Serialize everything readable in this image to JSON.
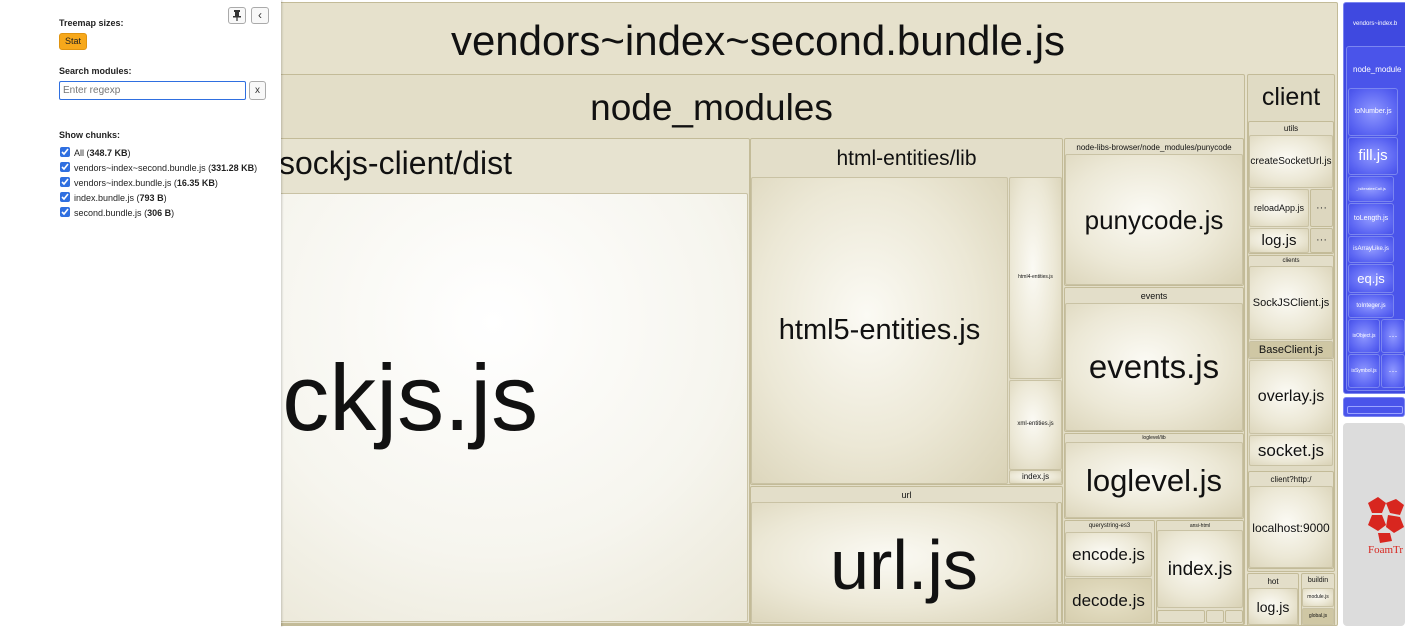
{
  "treemap": {
    "root_label": "vendors~index~second.bundle.js",
    "node_modules_label": "node_modules",
    "sockjs_dist_label": "sockjs-client/dist",
    "sockjs_file": "sockjs.js",
    "html_entities_lib_label": "html-entities/lib",
    "html5_entities": "html5-entities.js",
    "html4_entities": "html4-entities.js",
    "xml_entities": "xml-entities.js",
    "html_index": "index.js",
    "punycode_dir": "node-libs-browser/node_modules/punycode",
    "punycode_file": "punycode.js",
    "events_dir": "events",
    "events_file": "events.js",
    "loglevel_dir": "loglevel/lib",
    "loglevel_file": "loglevel.js",
    "url_dir": "url",
    "url_file": "url.js",
    "querystring_dir": "querystring-es3",
    "encode_file": "encode.js",
    "decode_file": "decode.js",
    "ansi_dir": "ansi-html",
    "ansi_index": "index.js",
    "client_label": "client",
    "utils_label": "utils",
    "create_socket_url": "createSocketUrl.js",
    "reload_app": "reloadApp.js",
    "log_file": "log.js",
    "ellipsis": "···",
    "clients_label": "clients",
    "sockjs_client_file": "SockJSClient.js",
    "base_client_file": "BaseClient.js",
    "overlay_file": "overlay.js",
    "socket_file": "socket.js",
    "client_http_label": "client?http:/",
    "localhost_file": "localhost:9000",
    "hot_label": "hot",
    "hot_log": "log.js",
    "buildin_label": "buildin",
    "module_file": "module.js",
    "global_file": "global.js"
  },
  "vendor_chunk": {
    "title": "vendors~index.b",
    "node_modules": "node_module",
    "to_number": "toNumber.js",
    "fill": "fill.js",
    "internal_call": "_isIterateeCall.js",
    "to_length": "toLength.js",
    "is_array_like": "isArrayLike.js",
    "eq": "eq.js",
    "to_integer": "toInteger.js",
    "is_object": "isObject.js",
    "is_symbol": "isSymbol.js",
    "ellipsis": "···"
  },
  "logo": {
    "text": "FoamTr"
  },
  "sidebar": {
    "pin_icon_glyph": "📌",
    "collapse_glyph": "‹",
    "sizes_heading": "Treemap sizes:",
    "stat_button": "Stat",
    "search_heading": "Search modules:",
    "search_placeholder": "Enter regexp",
    "clear_button": "x",
    "chunks_heading": "Show chunks:",
    "chunks": [
      {
        "name": "All",
        "size": "348.7 KB",
        "checked": true
      },
      {
        "name": "vendors~index~second.bundle.js",
        "size": "331.28 KB",
        "checked": true
      },
      {
        "name": "vendors~index.bundle.js",
        "size": "16.35 KB",
        "checked": true
      },
      {
        "name": "index.bundle.js",
        "size": "793 B",
        "checked": true
      },
      {
        "name": "second.bundle.js",
        "size": "306 B",
        "checked": true
      }
    ]
  },
  "colors": {
    "accent": "#f7a81b",
    "vendor_chunk": "#5a64f2"
  }
}
